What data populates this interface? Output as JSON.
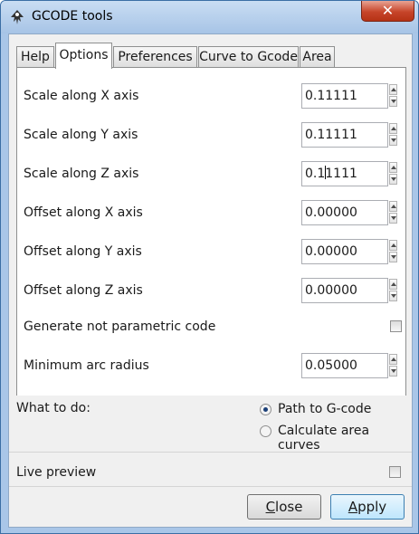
{
  "window": {
    "title": "GCODE tools",
    "close_glyph": "✕"
  },
  "tabs": [
    {
      "label": "Help"
    },
    {
      "label": "Options"
    },
    {
      "label": "Preferences"
    },
    {
      "label": "Curve to Gcode"
    },
    {
      "label": "Area"
    }
  ],
  "options": {
    "scale_x": {
      "label": "Scale along X axis",
      "value": "0.11111"
    },
    "scale_y": {
      "label": "Scale along Y axis",
      "value": "0.11111"
    },
    "scale_z": {
      "label": "Scale along Z axis",
      "value_before_caret": "0.1",
      "value_after_caret": "1111"
    },
    "offset_x": {
      "label": "Offset along X axis",
      "value": "0.00000"
    },
    "offset_y": {
      "label": "Offset along Y axis",
      "value": "0.00000"
    },
    "offset_z": {
      "label": "Offset along Z axis",
      "value": "0.00000"
    },
    "not_parametric": {
      "label": "Generate not parametric code",
      "checked": false
    },
    "min_arc_radius": {
      "label": "Minimum arc radius",
      "value": "0.05000"
    }
  },
  "what_to_do": {
    "label": "What to do:",
    "options": [
      {
        "label": "Path to G-code",
        "selected": true
      },
      {
        "label": "Calculate area curves",
        "selected": false
      }
    ]
  },
  "live_preview": {
    "label": "Live preview",
    "checked": false
  },
  "buttons": {
    "close": {
      "accel": "C",
      "rest": "lose"
    },
    "apply": {
      "accel": "A",
      "rest": "pply"
    }
  },
  "icons": {
    "app": "inkscape-icon",
    "close": "close-icon",
    "spin_up": "spin-up-arrow-icon",
    "spin_down": "spin-down-arrow-icon"
  },
  "colors": {
    "title_bar": "#a9c6e8",
    "close_button": "#c7452a",
    "default_button": "#bee6fd",
    "radio_dot": "#1b3f78"
  }
}
